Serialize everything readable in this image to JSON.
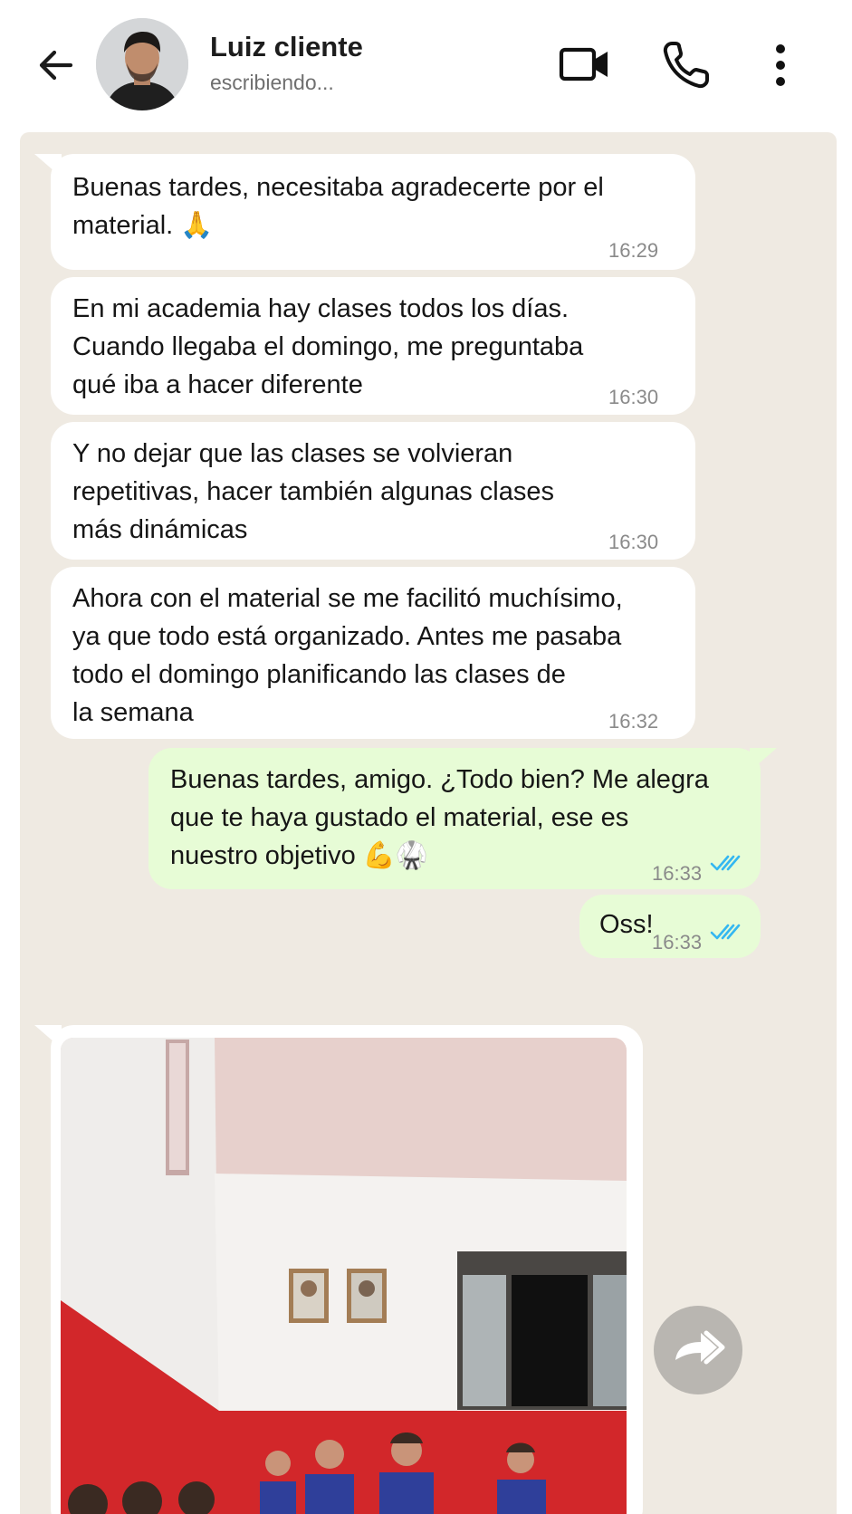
{
  "header": {
    "contact_name": "Luiz cliente",
    "status": "escribiendo...",
    "icons": [
      "back-arrow-icon",
      "avatar",
      "video-call-icon",
      "phone-icon",
      "more-vert-icon"
    ]
  },
  "colors": {
    "chat_bg": "#efeae2",
    "incoming_bubble": "#ffffff",
    "outgoing_bubble": "#e7fcd6",
    "read_ticks": "#34b7f1"
  },
  "messages": [
    {
      "direction": "in",
      "text": "Buenas tardes, necesitaba agradecerte por el\nmaterial. 🙏",
      "time": "16:29"
    },
    {
      "direction": "in",
      "text": "En mi academia hay clases todos los días.\nCuando llegaba el domingo, me preguntaba\nqué iba a hacer diferente",
      "time": "16:30"
    },
    {
      "direction": "in",
      "text": "Y no dejar que las clases se volvieran\nrepetitivas, hacer también algunas clases\nmás dinámicas",
      "time": "16:30"
    },
    {
      "direction": "in",
      "text": "Ahora con el material se me facilitó muchísimo,\nya que todo está organizado. Antes me pasaba\ntodo el domingo planificando las clases de\nla semana",
      "time": "16:32"
    },
    {
      "direction": "out",
      "text": "Buenas tardes, amigo. ¿Todo bien? Me alegra\nque te haya gustado el material, ese es\nnuestro objetivo 💪🥋",
      "time": "16:33",
      "read": true
    },
    {
      "direction": "out",
      "text": "Oss!",
      "time": "16:33",
      "read": true
    }
  ],
  "image_message": {
    "direction": "in",
    "forward_icon": "forward-icon"
  }
}
